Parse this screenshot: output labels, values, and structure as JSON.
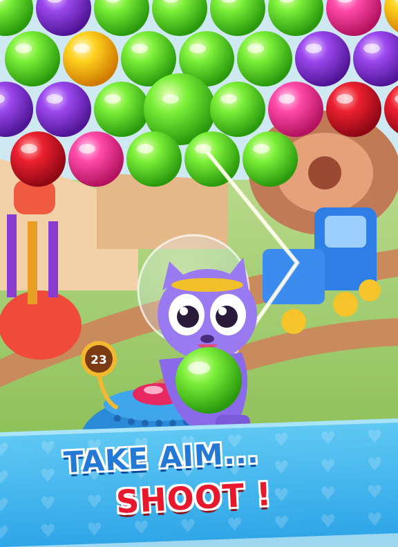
{
  "game": {
    "shots_remaining": "23",
    "banner_line1": "TAKE AIM...",
    "banner_line2": "SHOOT !",
    "loaded_bubble_color": "green"
  },
  "colors": {
    "green": "#5ee82a",
    "yellow": "#ffd21f",
    "purple": "#8d3be0",
    "pink": "#ff3fa0",
    "red": "#e4172b",
    "banner_blue": "#2fa6e8",
    "title_blue": "#2479d6",
    "title_red": "#e8182c"
  },
  "icons": {
    "character": "purple-cat-astronaut-icon",
    "launcher": "bubble-launcher-icon",
    "counter": "shots-counter-icon"
  }
}
